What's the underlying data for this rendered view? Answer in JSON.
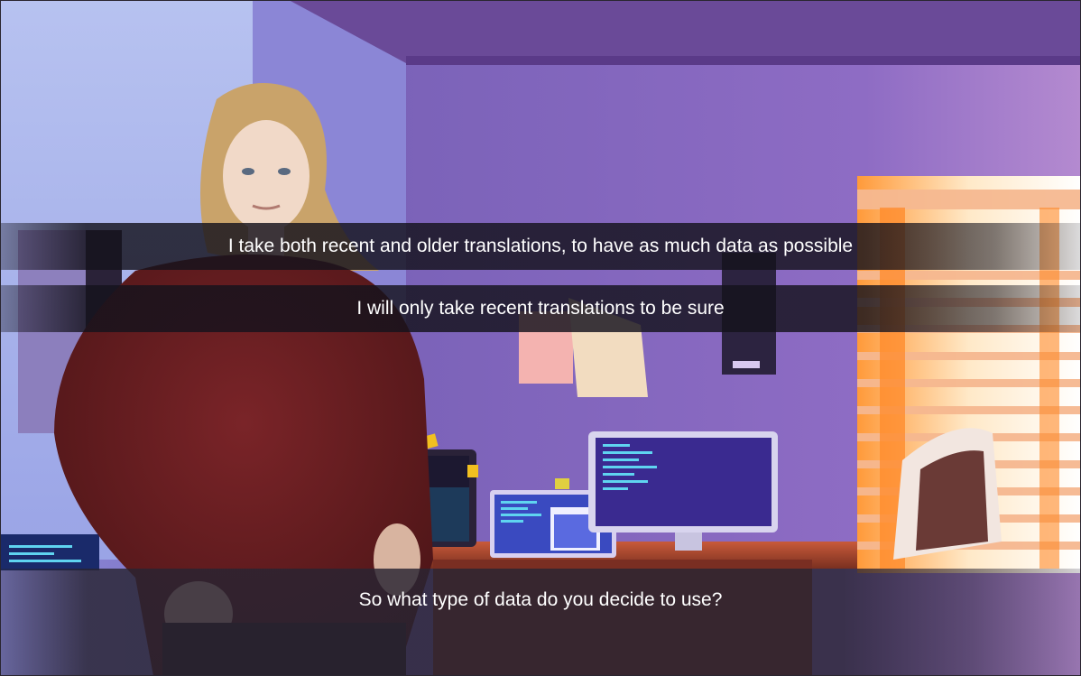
{
  "dialogue": {
    "choices": [
      {
        "label": "I take both recent and older translations, to have as much data as possible"
      },
      {
        "label": "I will only take recent translations to be sure"
      }
    ],
    "prompt": "So what type of data do you decide to use?"
  },
  "scene": {
    "setting": "office-room-with-computers",
    "character": "woman-curly-blond-hair-red-shirt"
  },
  "colors": {
    "wall": "#7d6bc0",
    "window_light": "#ffd9a8",
    "shirt": "#6d1f22",
    "screen_code": "#5fd4f0"
  }
}
